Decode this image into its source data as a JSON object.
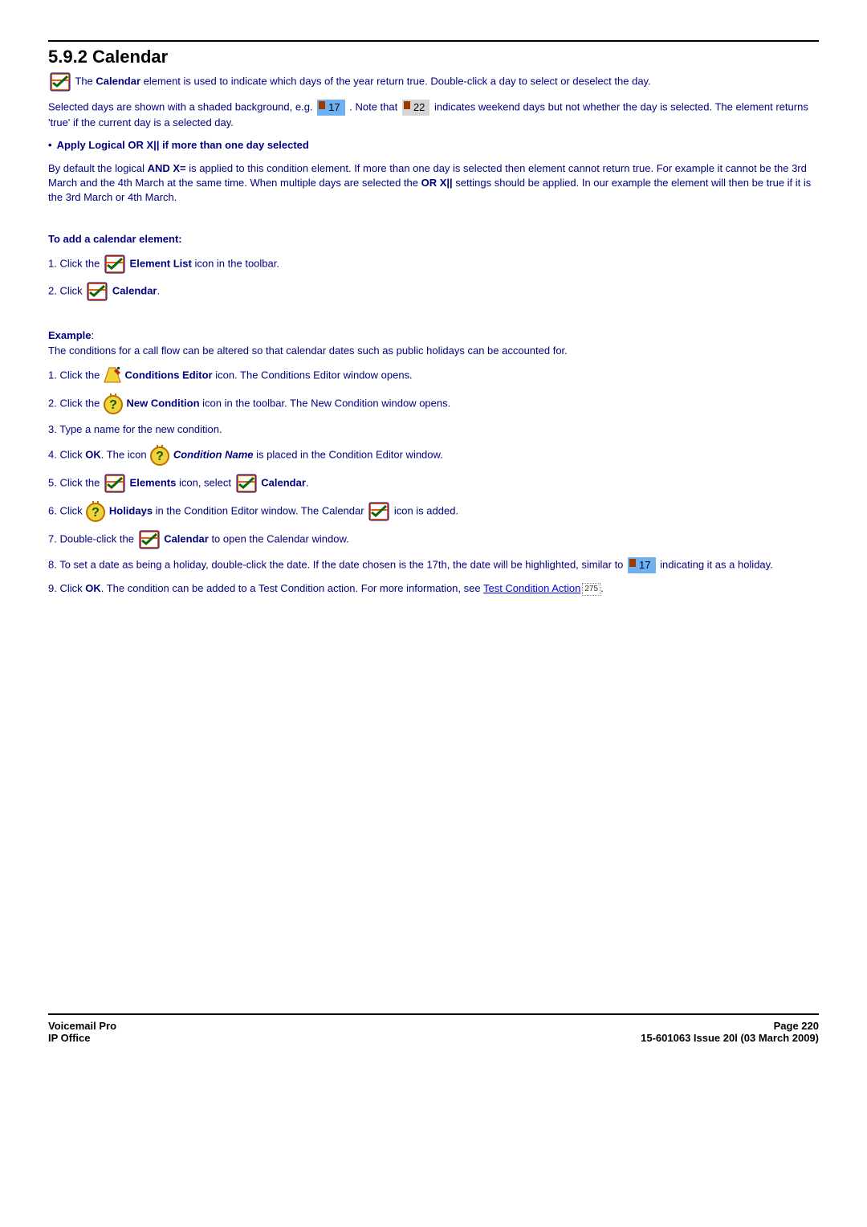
{
  "heading": "5.9.2 Calendar",
  "intro": {
    "p1a": " The ",
    "calendar_bold": "Calendar",
    "p1b": " element is used to indicate which days of the year return true. Double-click a day to select or deselect the day.",
    "p2a": "Selected days are shown with a shaded background, e.g. ",
    "day17": "17",
    "p2b": " . Note that ",
    "day22": "22",
    "p2c": " indicates weekend days but not whether the day is selected. The element returns 'true' if the current day is a selected day.",
    "bullet_heading": "Apply Logical OR X|| if more than one day selected",
    "p3a": "By default the logical ",
    "andx": "AND X=",
    "p3b": " is applied to this condition element. If more than one day is selected then element cannot return true. For example it cannot be the 3rd March and the 4th March at the same time. When multiple days are selected the ",
    "orx": "OR X||",
    "p3c": " settings should be applied. In our example the element will then be true if it is the 3rd March or 4th March."
  },
  "add": {
    "heading": "To add a calendar element:",
    "s1a": "1. Click the ",
    "el_list": "Element List",
    "s1b": " icon in the toolbar.",
    "s2a": "2. Click ",
    "calendar": "Calendar",
    "s2b": "."
  },
  "example": {
    "heading": "Example",
    "colon": ":",
    "intro": "The conditions for a call flow can be altered so that calendar dates such as public holidays can be accounted for.",
    "s1a": "1. Click the ",
    "cond_editor": "Conditions Editor",
    "s1b": " icon. The Conditions Editor window opens.",
    "s2a": "2. Click the ",
    "new_cond": "New Condition",
    "s2b": " icon in the toolbar. The New Condition window opens.",
    "s3": "3. Type a name for the new condition.",
    "s4a": "4. Click ",
    "ok": "OK",
    "s4b": ". The icon ",
    "cond_name": "Condition Name",
    "s4c": " is placed in the Condition Editor window.",
    "s5a": "5. Click the ",
    "elements": "Elements",
    "s5b": " icon, select ",
    "calendar": "Calendar",
    "s5c": ".",
    "s6a": "6. Click ",
    "holidays": "Holidays",
    "s6b": " in the Condition Editor window. The Calendar ",
    "s6c": " icon is added.",
    "s7a": "7. Double-click the ",
    "s7b": " to open the Calendar window.",
    "s8a": "8. To set a date as being a holiday, double-click the date. If the date chosen is the 17th, the date will be highlighted, similar to ",
    "day17": "17",
    "s8b": " indicating it as a holiday.",
    "s9a": "9. Click ",
    "s9b": ". The condition can be added to a Test Condition action. For more information, see ",
    "link_text": "Test Condition Action",
    "ref": "275",
    "s9c": "."
  },
  "footer": {
    "left1": "Voicemail Pro",
    "left2": "IP Office",
    "right1": "Page 220",
    "right2": "15-601063 Issue 20l (03 March 2009)"
  }
}
